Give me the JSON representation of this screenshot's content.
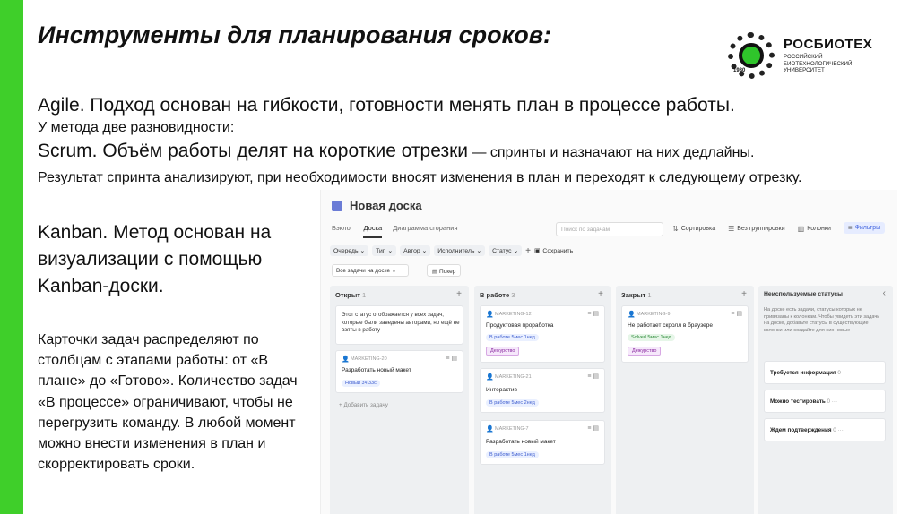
{
  "colors": {
    "accent": "#3fcf2a"
  },
  "title": "Инструменты для планирования сроков:",
  "logo": {
    "year": "1930",
    "name": "РОСБИОТЕХ",
    "subtitle": "Российский биотехнологический университет"
  },
  "agile": "Agile. Подход основан на гибкости, готовности менять план в процессе работы.",
  "subtypes": "У метода две разновидности:",
  "scrum": {
    "bold": "Scrum. Объём работы делят на короткие отрезки",
    "rest": " — спринты и назначают на них дедлайны."
  },
  "result": "Результат спринта анализируют, при необходимости вносят изменения в план и переходят к следующему отрезку.",
  "kanban": "Kanban. Метод основан на визуализации с помощью Kanban-доски.",
  "cards_text": " Карточки задач распределяют по столбцам с этапами работы: от «В плане» до «Готово». Количество задач «В процессе» ограничивают, чтобы не перегрузить команду. В любой момент можно внести изменения в план и скорректировать сроки.",
  "board": {
    "title": "Новая доска",
    "tabs": [
      "Бэклог",
      "Доска",
      "Диаграмма сгорания"
    ],
    "search_placeholder": "Поиск по задачам",
    "tools": {
      "sort": "Сортировка",
      "group": "Без группировки",
      "columns": "Колонки",
      "filters": "Фильтры"
    },
    "chips": [
      "Очередь",
      "Тип",
      "Автор",
      "Исполнитель",
      "Статус"
    ],
    "save": "Сохранить",
    "select_all": "Все задачи на доске",
    "poker": "Покер",
    "add_task": "Добавить задачу",
    "columns": [
      {
        "name": "Открыт",
        "count": "1"
      },
      {
        "name": "В работе",
        "count": "3"
      },
      {
        "name": "Закрыт",
        "count": "1"
      }
    ],
    "open_note": "Этот статус отображается у всех задач, которые были заведены авторами, но ещё не взяты в работу",
    "cards": {
      "c1": {
        "id": "MARKETING-20",
        "title": "Разработать новый макет",
        "badge": "Новый 3ч 33с"
      },
      "c2": {
        "id": "MARKETING-12",
        "title": "Продуктовая проработка",
        "badge": "В работе 5мес 1нед",
        "tag": "Дежурство"
      },
      "c3": {
        "id": "MARKETING-21",
        "title": "Интерактив",
        "badge": "В работе 5мес 2нед"
      },
      "c4": {
        "id": "MARKETING-7",
        "title": "Разработать новый макет",
        "badge": "В работе 5мес 1нед"
      },
      "c5": {
        "id": "MARKETING-9",
        "title": "Не работает скролл в браузере",
        "badge": "Solved 5мес 1нед",
        "tag": "Дежурство"
      }
    },
    "unused": {
      "title": "Неиспользуемые статусы",
      "desc": "На доске есть задачи, статусы которых не привязаны к колонкам. Чтобы увидеть эти задачи на доске, добавьте статусы в существующие колонки или создайте для них новые",
      "items": [
        {
          "name": "Требуется информация",
          "count": "0"
        },
        {
          "name": "Можно тестировать",
          "count": "0"
        },
        {
          "name": "Ждем подтверждения",
          "count": "0"
        }
      ]
    }
  }
}
